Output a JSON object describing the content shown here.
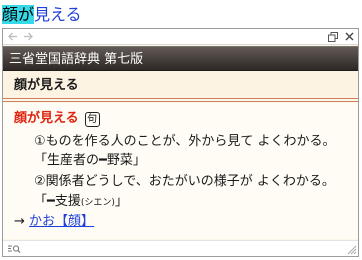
{
  "query": {
    "highlighted": "顔が",
    "rest": "見える"
  },
  "toolbar": {
    "back_icon": "arrow-left-icon",
    "forward_icon": "arrow-right-icon",
    "restore_icon": "restore-window-icon",
    "close_icon": "close-icon"
  },
  "dictionary": {
    "title": "三省堂国語辞典 第七版"
  },
  "headword_bar": {
    "label": "顔が見える"
  },
  "entry": {
    "headword": "顔が見える",
    "badge": "句",
    "sense1": "①ものを作る人のことが、外から見て よくわかる。",
    "example1": "「生産者の━野菜」",
    "sense2": "②関係者どうしで、おたがいの様子が よくわかる。",
    "example2_prefix": "「━支援",
    "example2_ruby": "(シエン)",
    "example2_suffix": "」",
    "crossref_arrow": "→",
    "crossref_link": "かお【顔】"
  },
  "statusbar": {
    "search_icon": "search-list-icon",
    "grip_icon": "resize-grip-icon"
  },
  "colors": {
    "highlight": "#35d9e8",
    "query_text": "#1f3fd8",
    "headword": "#e0230f",
    "link": "#1f3fd8",
    "header_bg": "#453e3a"
  }
}
